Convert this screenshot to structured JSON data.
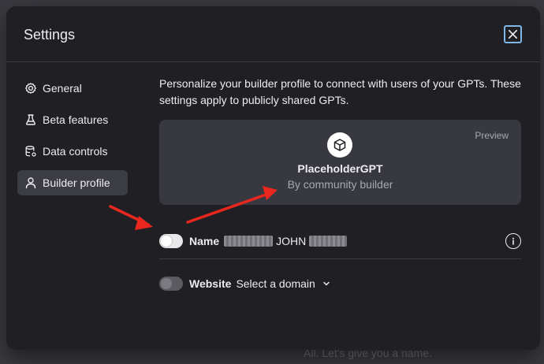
{
  "background": {
    "hint_text": "All. Let's give you a name."
  },
  "modal": {
    "title": "Settings",
    "close_icon": "close-icon"
  },
  "sidebar": {
    "items": [
      {
        "label": "General",
        "icon": "gear-icon"
      },
      {
        "label": "Beta features",
        "icon": "flask-icon"
      },
      {
        "label": "Data controls",
        "icon": "database-icon"
      },
      {
        "label": "Builder profile",
        "icon": "user-icon",
        "active": true
      }
    ]
  },
  "builder": {
    "description": "Personalize your builder profile to connect with users of your GPTs. These settings apply to publicly shared GPTs.",
    "preview": {
      "tag": "Preview",
      "gpt_name": "PlaceholderGPT",
      "byline": "By community builder"
    },
    "name_row": {
      "label": "Name",
      "visible_text": "JOHN",
      "toggle_on": true
    },
    "website_row": {
      "label": "Website",
      "select_value": "Select a domain",
      "toggle_on": false
    }
  },
  "colors": {
    "annotation_arrow": "#e8271f",
    "modal_bg": "#202024",
    "card_bg": "#383840",
    "close_border": "#7eb6e8"
  }
}
